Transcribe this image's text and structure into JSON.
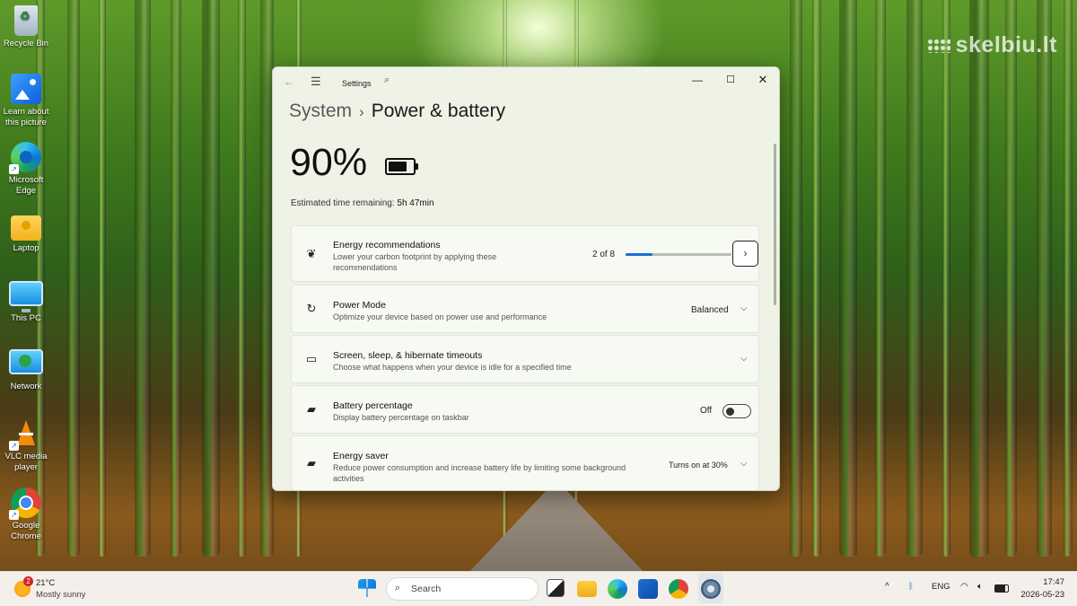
{
  "watermark": "skelbiu.lt",
  "desktop_icons": [
    {
      "label": "Recycle Bin",
      "icon": "recycle-bin-icon"
    },
    {
      "label": "Learn about this picture",
      "icon": "picture-icon"
    },
    {
      "label": "Microsoft Edge",
      "icon": "edge-icon"
    },
    {
      "label": "Laptop",
      "icon": "user-folder-icon"
    },
    {
      "label": "This PC",
      "icon": "monitor-icon"
    },
    {
      "label": "Network",
      "icon": "network-icon"
    },
    {
      "label": "VLC media player",
      "icon": "vlc-icon"
    },
    {
      "label": "Google Chrome",
      "icon": "chrome-icon"
    }
  ],
  "window": {
    "app_title": "Settings",
    "breadcrumb_parent": "System",
    "breadcrumb_sep": "›",
    "breadcrumb_current": "Power & battery",
    "battery_percent": "90%",
    "battery_level": 0.9,
    "estimate_label": "Estimated time remaining:",
    "estimate_value": "5h 47min"
  },
  "cards": {
    "energy_rec": {
      "title": "Energy recommendations",
      "desc": "Lower your carbon footprint by applying these recommendations",
      "value": "2 of 8",
      "progress": 0.25
    },
    "power_mode": {
      "title": "Power Mode",
      "desc": "Optimize your device based on power use and performance",
      "value": "Balanced"
    },
    "timeouts": {
      "title": "Screen, sleep, & hibernate timeouts",
      "desc": "Choose what happens when your device is idle for a specified time"
    },
    "battery_pct": {
      "title": "Battery percentage",
      "desc": "Display battery percentage on taskbar",
      "value": "Off"
    },
    "energy_saver": {
      "title": "Energy saver",
      "desc": "Reduce power consumption and increase battery life by limiting some background activities",
      "value": "Turns on at 30%"
    }
  },
  "taskbar": {
    "weather_badge": "2",
    "weather_temp": "21°C",
    "weather_cond": "Mostly sunny",
    "search_label": "Search",
    "language": "ENG",
    "time": "17:47",
    "date": "2026-05-23"
  },
  "colors": {
    "accent": "#1a6ed6",
    "window_bg": "#eef3e6"
  }
}
